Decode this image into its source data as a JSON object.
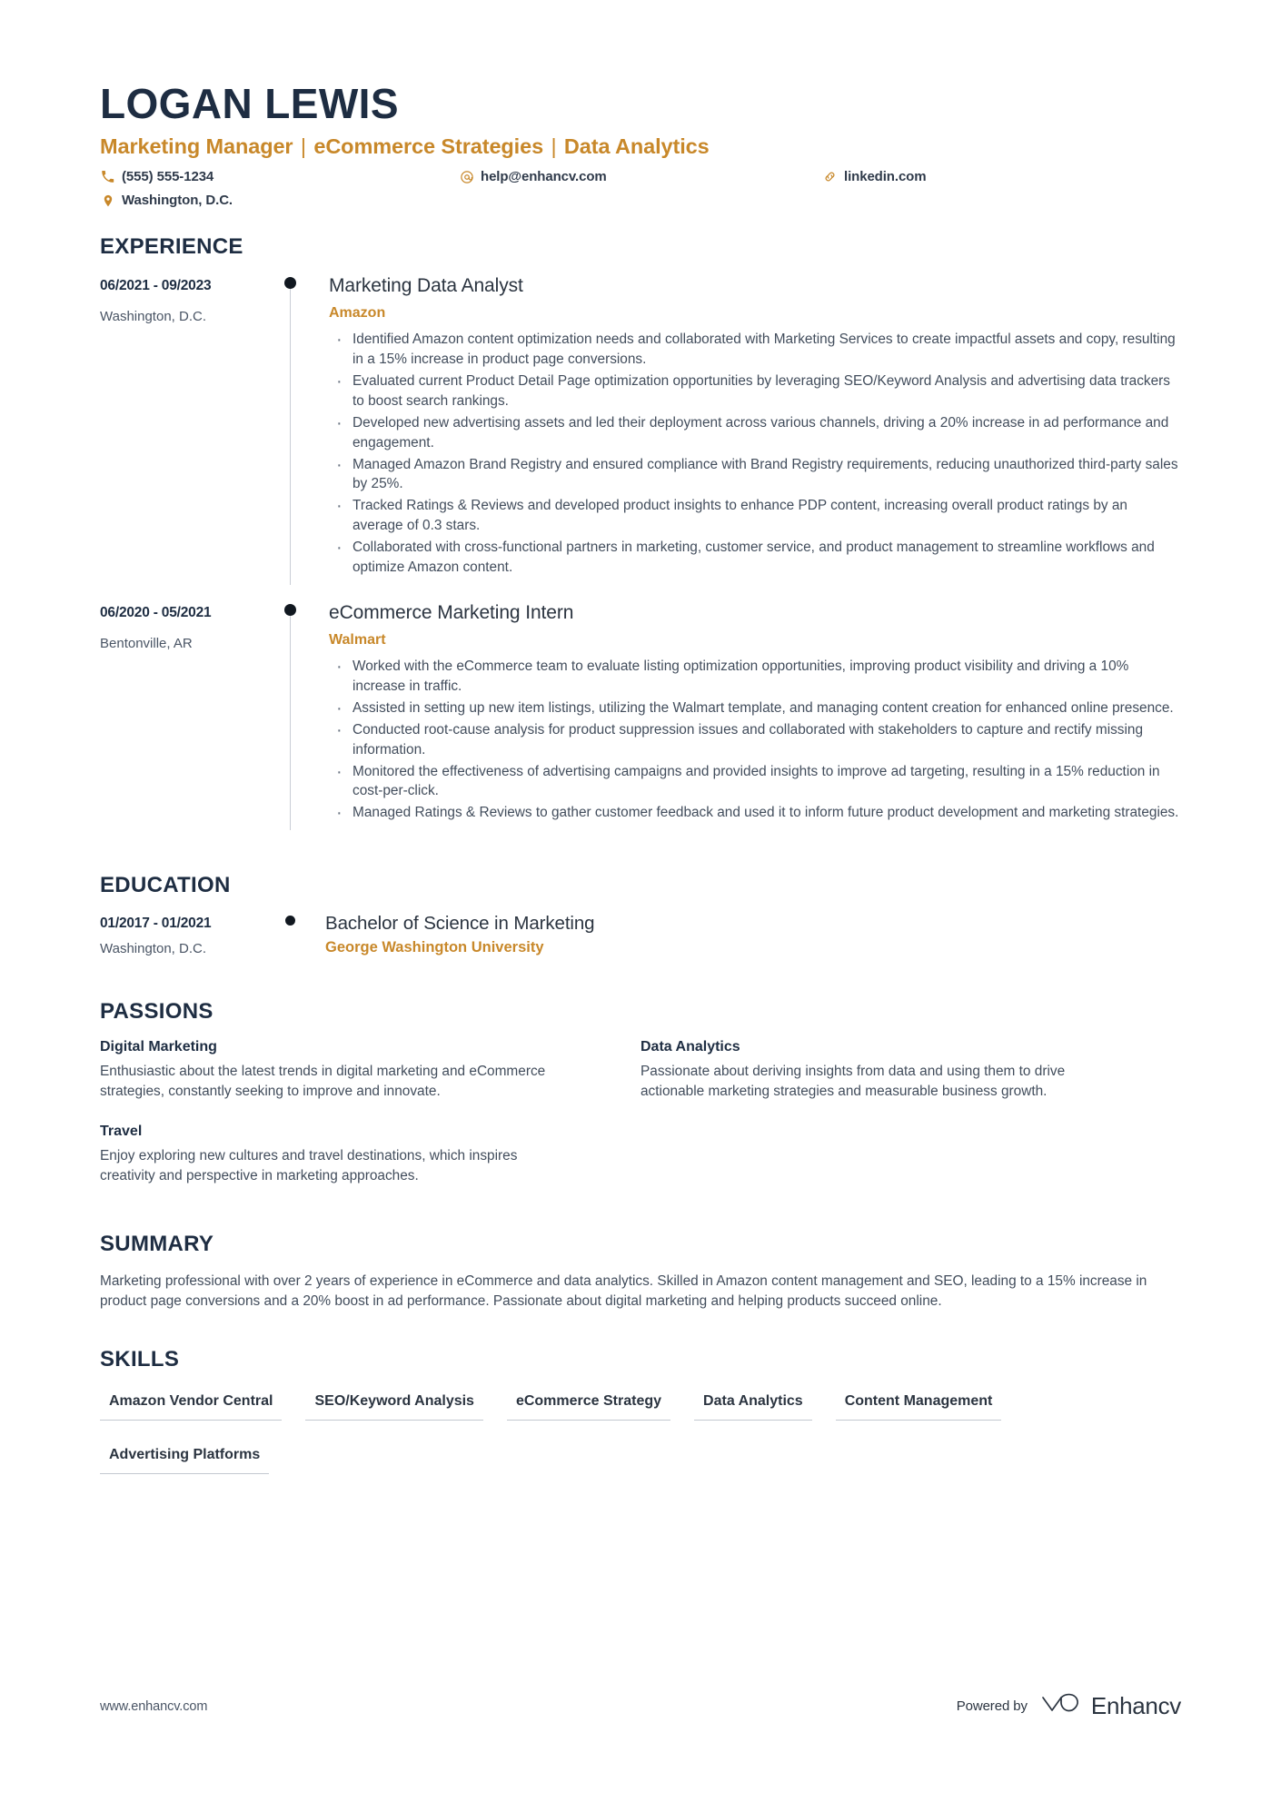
{
  "colors": {
    "accent": "#c8882a",
    "dark": "#1e2d42",
    "body": "#424d5c",
    "rule": "#c2c8d0"
  },
  "header": {
    "name": "LOGAN LEWIS",
    "headline_parts": [
      "Marketing Manager",
      "eCommerce Strategies",
      "Data Analytics"
    ],
    "headline": "Marketing Manager | eCommerce Strategies | Data Analytics",
    "contacts": {
      "phone": "(555) 555-1234",
      "email": "help@enhancv.com",
      "link": "linkedin.com",
      "location": "Washington, D.C."
    }
  },
  "sections": {
    "experience_title": "EXPERIENCE",
    "education_title": "EDUCATION",
    "passions_title": "PASSIONS",
    "summary_title": "SUMMARY",
    "skills_title": "SKILLS"
  },
  "experience": [
    {
      "date": "06/2021 - 09/2023",
      "location": "Washington, D.C.",
      "title": "Marketing Data Analyst",
      "company": "Amazon",
      "bullets": [
        "Identified Amazon content optimization needs and collaborated with Marketing Services to create impactful assets and copy, resulting in a 15% increase in product page conversions.",
        "Evaluated current Product Detail Page optimization opportunities by leveraging SEO/Keyword Analysis and advertising data trackers to boost search rankings.",
        "Developed new advertising assets and led their deployment across various channels, driving a 20% increase in ad performance and engagement.",
        "Managed Amazon Brand Registry and ensured compliance with Brand Registry requirements, reducing unauthorized third-party sales by 25%.",
        "Tracked Ratings & Reviews and developed product insights to enhance PDP content, increasing overall product ratings by an average of 0.3 stars.",
        "Collaborated with cross-functional partners in marketing, customer service, and product management to streamline workflows and optimize Amazon content."
      ]
    },
    {
      "date": "06/2020 - 05/2021",
      "location": "Bentonville, AR",
      "title": "eCommerce Marketing Intern",
      "company": "Walmart",
      "bullets": [
        "Worked with the eCommerce team to evaluate listing optimization opportunities, improving product visibility and driving a 10% increase in traffic.",
        "Assisted in setting up new item listings, utilizing the Walmart template, and managing content creation for enhanced online presence.",
        "Conducted root-cause analysis for product suppression issues and collaborated with stakeholders to capture and rectify missing information.",
        "Monitored the effectiveness of advertising campaigns and provided insights to improve ad targeting, resulting in a 15% reduction in cost-per-click.",
        "Managed Ratings & Reviews to gather customer feedback and used it to inform future product development and marketing strategies."
      ]
    }
  ],
  "education": [
    {
      "date": "01/2017 - 01/2021",
      "location": "Washington, D.C.",
      "degree": "Bachelor of Science in Marketing",
      "school": "George Washington University"
    }
  ],
  "passions": [
    {
      "title": "Digital Marketing",
      "description": "Enthusiastic about the latest trends in digital marketing and eCommerce strategies, constantly seeking to improve and innovate."
    },
    {
      "title": "Data Analytics",
      "description": "Passionate about deriving insights from data and using them to drive actionable marketing strategies and measurable business growth."
    },
    {
      "title": "Travel",
      "description": "Enjoy exploring new cultures and travel destinations, which inspires creativity and perspective in marketing approaches."
    }
  ],
  "summary": "Marketing professional with over 2 years of experience in eCommerce and data analytics. Skilled in Amazon content management and SEO, leading to a 15% increase in product page conversions and a 20% boost in ad performance. Passionate about digital marketing and helping products succeed online.",
  "skills": [
    "Amazon Vendor Central",
    "SEO/Keyword Analysis",
    "eCommerce Strategy",
    "Data Analytics",
    "Content Management",
    "Advertising Platforms"
  ],
  "footer": {
    "url": "www.enhancv.com",
    "powered_by": "Powered by",
    "brand": "Enhancv"
  }
}
